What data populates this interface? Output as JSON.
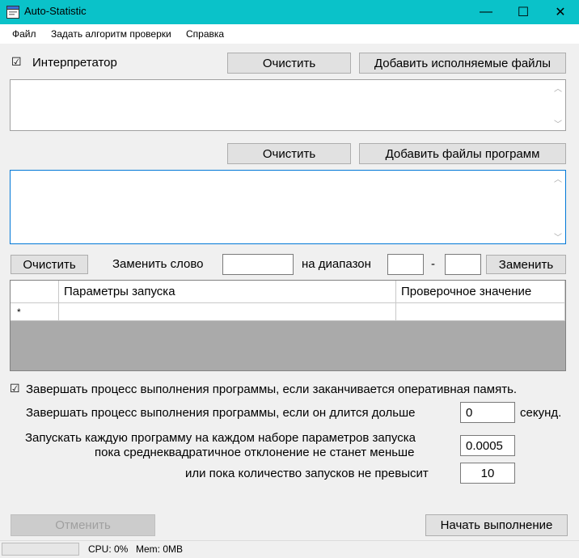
{
  "window": {
    "title": "Auto-Statistic",
    "minimize_glyph": "—",
    "maximize_glyph": "☐",
    "close_glyph": "✕"
  },
  "menu": [
    "Файл",
    "Задать алгоритм проверки",
    "Справка"
  ],
  "interpreter": {
    "checkbox_mark": "☑",
    "label": "Интерпретатор",
    "clear_label": "Очистить",
    "add_label": "Добавить исполняемые файлы"
  },
  "programs": {
    "clear_label": "Очистить",
    "add_label": "Добавить файлы программ"
  },
  "replace": {
    "clear_label": "Очистить",
    "replace_word_label": "Заменить слово",
    "range_label": "на диапазон",
    "dash": "-",
    "button_label": "Заменить",
    "word_value": "",
    "from_value": "",
    "to_value": ""
  },
  "grid": {
    "columns": [
      "",
      "Параметры запуска",
      "Проверочное значение"
    ],
    "new_row_marker": "*"
  },
  "options": {
    "memory_checkbox_mark": "☑",
    "memory_label": "Завершать процесс выполнения программы, если заканчивается оперативная память.",
    "timeout_label": "Завершать процесс выполнения программы, если он длится дольше",
    "timeout_value": "0",
    "timeout_unit": "секунд.",
    "stddev_label_line1": "Запускать каждую программу на каждом наборе параметров запуска",
    "stddev_label_line2": "пока среднеквадратичное отклонение не станет меньше",
    "stddev_value": "0.0005",
    "runs_label": "или пока количество запусков не превысит",
    "runs_value": "10"
  },
  "actions": {
    "cancel_label": "Отменить",
    "start_label": "Начать выполнение"
  },
  "status": {
    "cpu": "CPU: 0%",
    "mem": "Mem: 0MB"
  },
  "colors": {
    "titlebar": "#0ac2c9",
    "focus_border": "#0078d7"
  }
}
